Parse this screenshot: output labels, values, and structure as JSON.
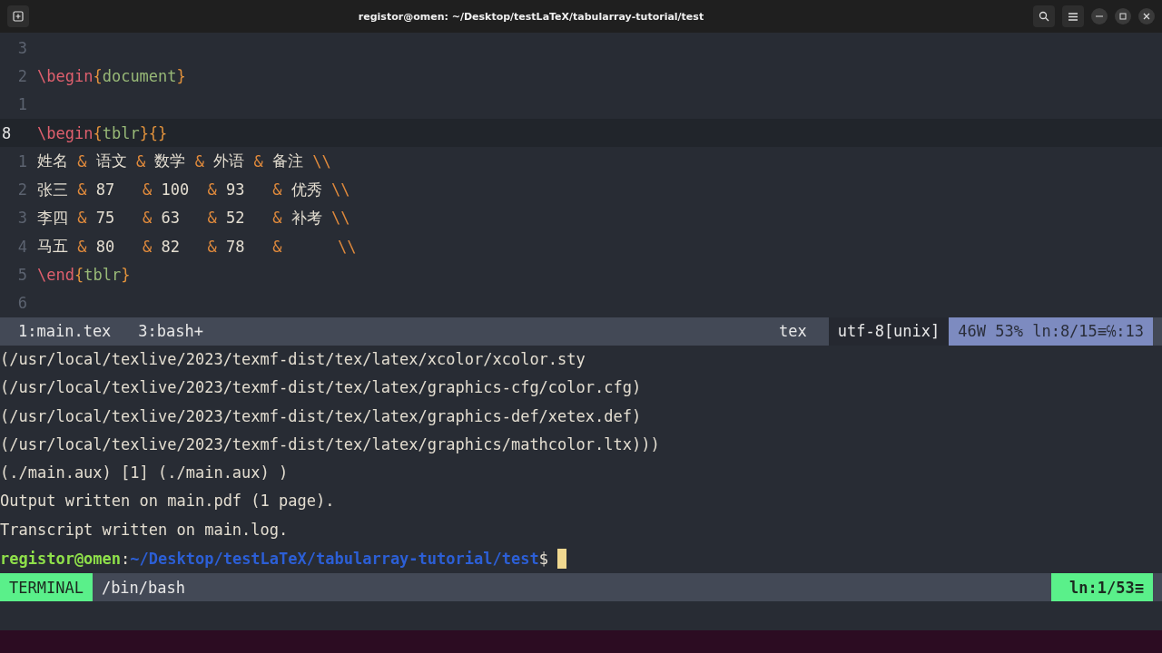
{
  "window": {
    "title": "registor@omen: ~/Desktop/testLaTeX/tabularray-tutorial/test"
  },
  "editor": {
    "lines": [
      {
        "number": "3",
        "selected": false
      },
      {
        "number": "2",
        "selected": false,
        "segments": [
          {
            "kind": "command",
            "text": "\\begin"
          },
          {
            "kind": "brace",
            "text": "{"
          },
          {
            "kind": "argument",
            "text": "document"
          },
          {
            "kind": "brace",
            "text": "}"
          }
        ]
      },
      {
        "number": "1",
        "selected": false
      },
      {
        "number": "8",
        "selected": true,
        "segments": [
          {
            "kind": "command",
            "text": "\\begin"
          },
          {
            "kind": "brace",
            "text": "{"
          },
          {
            "kind": "argument",
            "text": "tblr"
          },
          {
            "kind": "brace",
            "text": "}{}"
          }
        ]
      },
      {
        "number": "1",
        "selected": false,
        "segments": [
          {
            "kind": "text",
            "text": "姓名 "
          },
          {
            "kind": "operator",
            "text": "&"
          },
          {
            "kind": "text",
            "text": " 语文 "
          },
          {
            "kind": "operator",
            "text": "&"
          },
          {
            "kind": "text",
            "text": " 数学 "
          },
          {
            "kind": "operator",
            "text": "&"
          },
          {
            "kind": "text",
            "text": " 外语 "
          },
          {
            "kind": "operator",
            "text": "&"
          },
          {
            "kind": "text",
            "text": " 备注 "
          },
          {
            "kind": "operator",
            "text": "\\\\"
          }
        ]
      },
      {
        "number": "2",
        "selected": false,
        "segments": [
          {
            "kind": "text",
            "text": "张三 "
          },
          {
            "kind": "operator",
            "text": "&"
          },
          {
            "kind": "text",
            "text": " 87   "
          },
          {
            "kind": "operator",
            "text": "&"
          },
          {
            "kind": "text",
            "text": " 100  "
          },
          {
            "kind": "operator",
            "text": "&"
          },
          {
            "kind": "text",
            "text": " 93   "
          },
          {
            "kind": "operator",
            "text": "&"
          },
          {
            "kind": "text",
            "text": " 优秀 "
          },
          {
            "kind": "operator",
            "text": "\\\\"
          }
        ]
      },
      {
        "number": "3",
        "selected": false,
        "segments": [
          {
            "kind": "text",
            "text": "李四 "
          },
          {
            "kind": "operator",
            "text": "&"
          },
          {
            "kind": "text",
            "text": " 75   "
          },
          {
            "kind": "operator",
            "text": "&"
          },
          {
            "kind": "text",
            "text": " 63   "
          },
          {
            "kind": "operator",
            "text": "&"
          },
          {
            "kind": "text",
            "text": " 52   "
          },
          {
            "kind": "operator",
            "text": "&"
          },
          {
            "kind": "text",
            "text": " 补考 "
          },
          {
            "kind": "operator",
            "text": "\\\\"
          }
        ]
      },
      {
        "number": "4",
        "selected": false,
        "segments": [
          {
            "kind": "text",
            "text": "马五 "
          },
          {
            "kind": "operator",
            "text": "&"
          },
          {
            "kind": "text",
            "text": " 80   "
          },
          {
            "kind": "operator",
            "text": "&"
          },
          {
            "kind": "text",
            "text": " 82   "
          },
          {
            "kind": "operator",
            "text": "&"
          },
          {
            "kind": "text",
            "text": " 78   "
          },
          {
            "kind": "operator",
            "text": "&"
          },
          {
            "kind": "operator",
            "text": "      \\\\"
          }
        ]
      },
      {
        "number": "5",
        "selected": false,
        "segments": [
          {
            "kind": "command",
            "text": "\\end"
          },
          {
            "kind": "brace",
            "text": "{"
          },
          {
            "kind": "argument",
            "text": "tblr"
          },
          {
            "kind": "brace",
            "text": "}"
          }
        ]
      },
      {
        "number": "6",
        "selected": false
      }
    ]
  },
  "status_line": {
    "buffers": [
      "1:main.tex",
      "3:bash+"
    ],
    "filetype": "tex",
    "encoding": "utf-8[unix]",
    "position": "46W 53% ln:8/15≡℅:13"
  },
  "terminal": {
    "output": [
      "(/usr/local/texlive/2023/texmf-dist/tex/latex/xcolor/xcolor.sty",
      "(/usr/local/texlive/2023/texmf-dist/tex/latex/graphics-cfg/color.cfg)",
      "(/usr/local/texlive/2023/texmf-dist/tex/latex/graphics-def/xetex.def)",
      "(/usr/local/texlive/2023/texmf-dist/tex/latex/graphics/mathcolor.ltx)))",
      "(./main.aux) [1] (./main.aux) )",
      "Output written on main.pdf (1 page).",
      "Transcript written on main.log."
    ],
    "prompt": {
      "user": "registor@omen",
      "separator": ":",
      "path": "~/Desktop/testLaTeX/tabularray-tutorial/test",
      "symbol": "$"
    }
  },
  "terminal_bar": {
    "mode": "TERMINAL",
    "shell": "/bin/bash",
    "position": "ln:1/53≡"
  }
}
